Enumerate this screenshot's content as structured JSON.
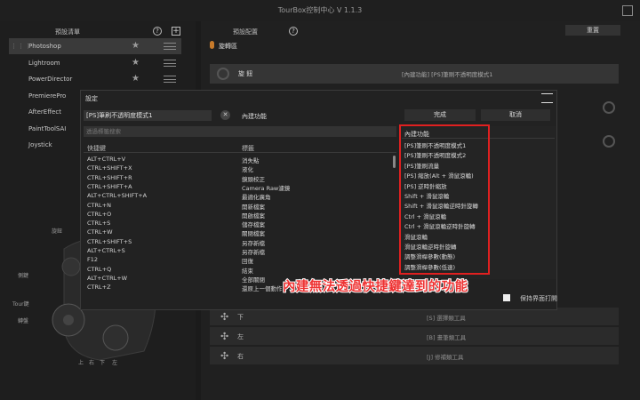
{
  "app": {
    "title": "TourBox控制中心 V 1.1.3"
  },
  "left": {
    "header_title": "預設清單",
    "items": [
      {
        "label": "Photoshop"
      },
      {
        "label": "Lightroom"
      },
      {
        "label": "PowerDirector"
      },
      {
        "label": "PremierePro"
      },
      {
        "label": "AfterEffect"
      },
      {
        "label": "PaintToolSAI"
      },
      {
        "label": "Joystick"
      }
    ],
    "device_labels": {
      "knob": "旋鈕",
      "side": "側鍵",
      "tour": "Tour鍵",
      "wheel": "轉盤",
      "dpad": [
        "上",
        "右",
        "下",
        "左"
      ]
    }
  },
  "right": {
    "header_title": "預設配置",
    "reset_label": "重置",
    "section_label": "旋轉區",
    "knob_name": "旋 鈕",
    "knob_func": "[內建功能] [PS]筆刷不透明度模式1",
    "dpad_rows": [
      {
        "label": "下",
        "func": "[S] 選擇類工具"
      },
      {
        "label": "左",
        "func": "[B] 畫筆類工具"
      },
      {
        "label": "右",
        "func": "[J] 修補類工具"
      }
    ]
  },
  "dialog": {
    "title": "設定",
    "shortcut_value": "[PS]筆刷不透明度模式1",
    "builtin_label": "內建功能",
    "done_label": "完成",
    "cancel_label": "取消",
    "search_placeholder": "透過標籤搜索",
    "col_shortcut": "快捷鍵",
    "col_label": "標籤",
    "rows": [
      {
        "sc": "ALT+CTRL+V",
        "lbl": "消失點"
      },
      {
        "sc": "CTRL+SHIFT+X",
        "lbl": "液化"
      },
      {
        "sc": "CTRL+SHIFT+R",
        "lbl": "鏡頭校正"
      },
      {
        "sc": "CTRL+SHIFT+A",
        "lbl": "Camera Raw濾鏡"
      },
      {
        "sc": "ALT+CTRL+SHIFT+A",
        "lbl": "最適化廣角"
      },
      {
        "sc": "CTRL+N",
        "lbl": "開新檔案"
      },
      {
        "sc": "CTRL+O",
        "lbl": "開啟檔案"
      },
      {
        "sc": "CTRL+S",
        "lbl": "儲存檔案"
      },
      {
        "sc": "CTRL+W",
        "lbl": "關閉檔案"
      },
      {
        "sc": "CTRL+SHIFT+S",
        "lbl": "另存新檔"
      },
      {
        "sc": "ALT+CTRL+S",
        "lbl": "另存新檔"
      },
      {
        "sc": "F12",
        "lbl": "回復"
      },
      {
        "sc": "CTRL+Q",
        "lbl": "結束"
      },
      {
        "sc": "ALT+CTRL+W",
        "lbl": "全部關閉"
      },
      {
        "sc": "CTRL+Z",
        "lbl": "還原上一個動作"
      }
    ],
    "builtin_title": "內建功能",
    "builtin_items": [
      "[PS]筆刷不透明度模式1",
      "[PS]筆刷不透明度模式2",
      "[PS]筆刷流量",
      "[PS] 縮放(Alt + 滑鼠滾輪)",
      "[PS] 逆時針縮放",
      "Shift + 滑鼠滾輪",
      "Shift + 滑鼠滾輪逆時針旋轉",
      "Ctrl + 滑鼠滾輪",
      "Ctrl + 滑鼠滾輪逆時針旋轉",
      "滑鼠滾輪",
      "滑鼠滾輪逆時針旋轉",
      "調整滑桿參數(動態)",
      "調整滑桿參數(低速)"
    ],
    "keep_open_label": "保持界面打開"
  },
  "annotation": "內建無法透過快捷鍵達到的功能",
  "colors": {
    "highlight": "#e02020",
    "annotation": "#e33333",
    "section_dot": "#c77a2a"
  }
}
